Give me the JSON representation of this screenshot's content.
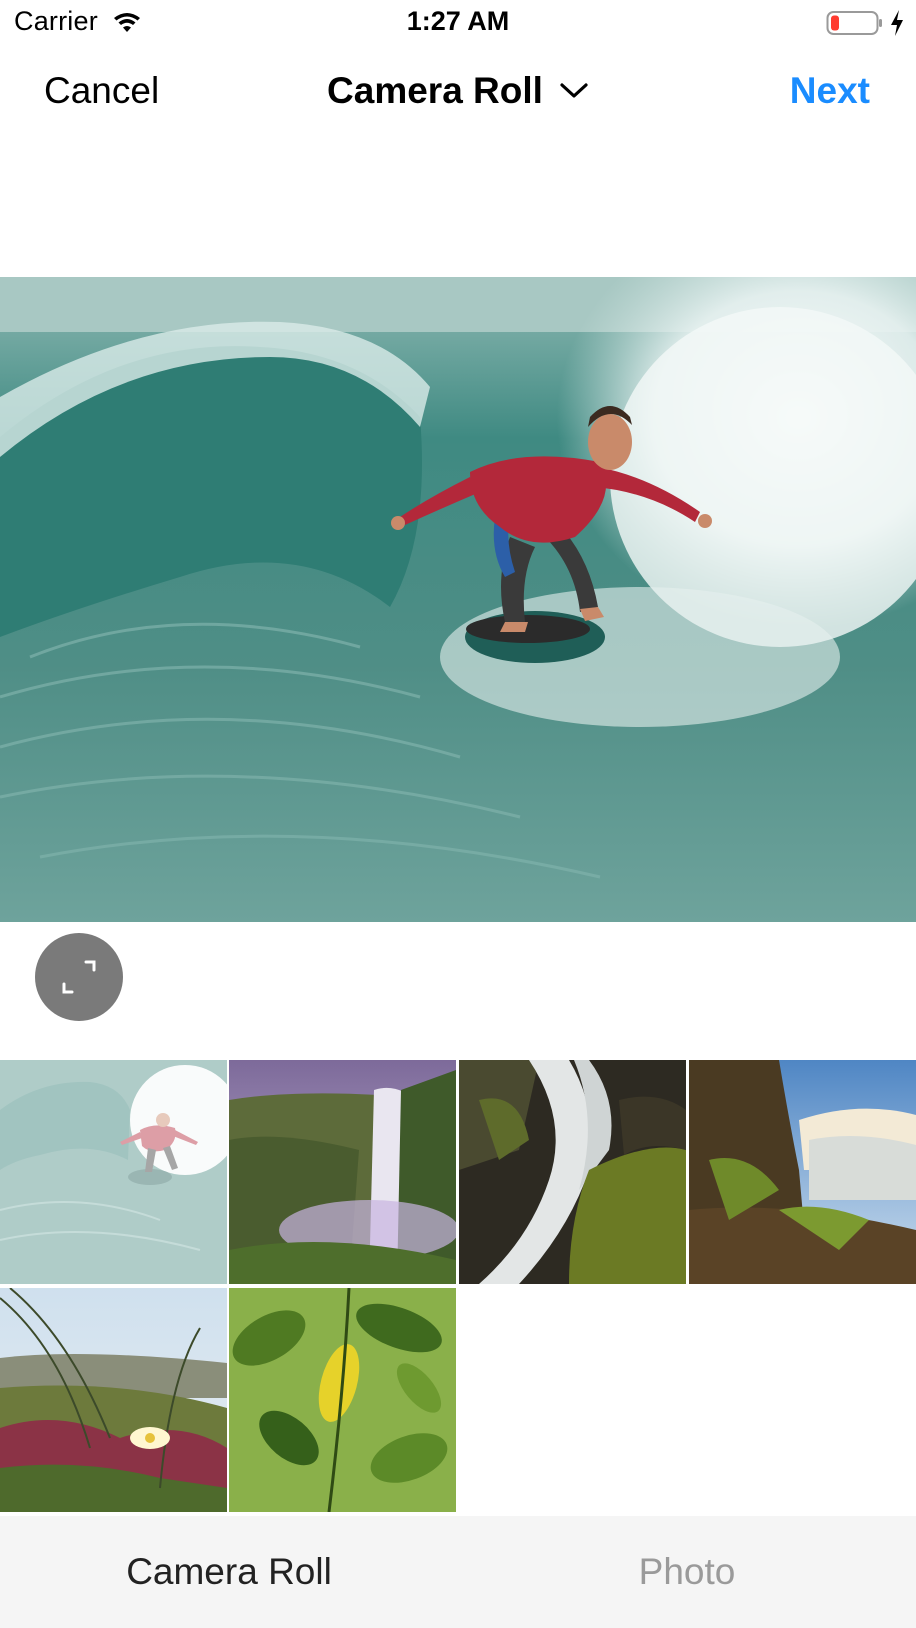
{
  "status_bar": {
    "carrier": "Carrier",
    "time": "1:27 AM",
    "battery_color": "#ff3b30"
  },
  "nav": {
    "cancel_label": "Cancel",
    "title": "Camera Roll",
    "next_label": "Next",
    "accent_color": "#1a8cff"
  },
  "preview": {
    "description_icon": "photo-preview"
  },
  "grid": {
    "thumbnails": [
      {
        "name": "thumb-surfer",
        "selected": true
      },
      {
        "name": "thumb-waterfall-purple"
      },
      {
        "name": "thumb-waterfall-rocks"
      },
      {
        "name": "thumb-waterfall-wide"
      },
      {
        "name": "thumb-beach-flower"
      },
      {
        "name": "thumb-leaves"
      }
    ]
  },
  "tabs": {
    "left_label": "Camera Roll",
    "right_label": "Photo"
  }
}
